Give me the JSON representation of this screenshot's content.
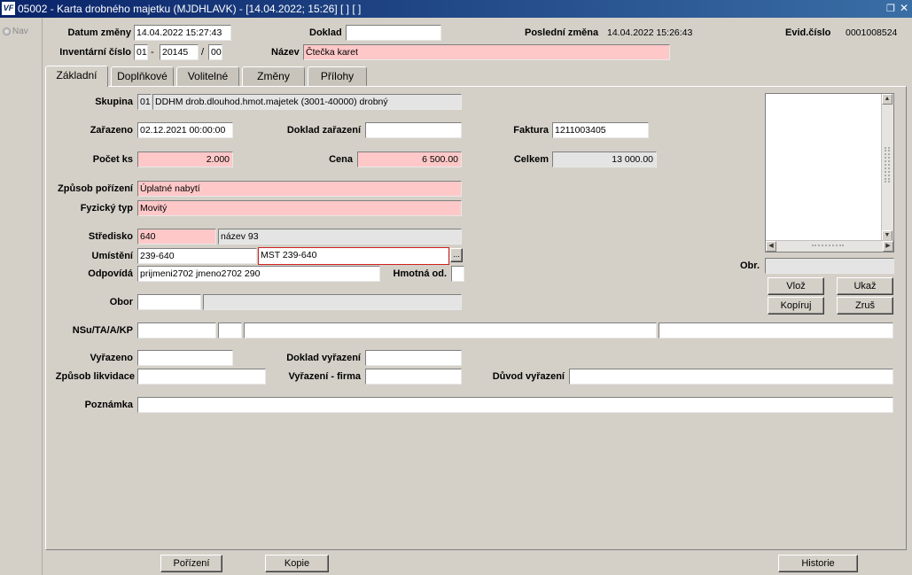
{
  "window": {
    "title": "05002 - Karta drobného majetku (MJDHLAVK) - [14.04.2022; 15:26]  [ ]  [ ]",
    "logo": "VF"
  },
  "nav": {
    "label": "Nav"
  },
  "header": {
    "datum_zmeny_label": "Datum změny",
    "datum_zmeny": "14.04.2022 15:27:43",
    "doklad_label": "Doklad",
    "doklad": "",
    "posledni_zmena_label": "Poslední změna",
    "posledni_zmena": "14.04.2022 15:26:43",
    "evid_cislo_label": "Evid.číslo",
    "evid_cislo": "0001008524",
    "inv_cislo_label": "Inventární číslo",
    "inv_1": "01",
    "inv_sep1": "-",
    "inv_2": "20145",
    "inv_sep2": "/",
    "inv_3": "00",
    "nazev_label": "Název",
    "nazev": "Čtečka karet"
  },
  "tabs": [
    "Základní",
    "Doplňkové",
    "Volitelné",
    "Změny",
    "Přílohy"
  ],
  "form": {
    "skupina_label": "Skupina",
    "skupina_kod": "01",
    "skupina_text": "DDHM drob.dlouhod.hmot.majetek (3001-40000) drobný",
    "zarazeno_label": "Zařazeno",
    "zarazeno": "02.12.2021 00:00:00",
    "doklad_zarazeni_label": "Doklad zařazení",
    "doklad_zarazeni": "",
    "faktura_label": "Faktura",
    "faktura": "1211003405",
    "pocet_label": "Počet ks",
    "pocet": "2.000",
    "cena_label": "Cena",
    "cena": "6 500.00",
    "celkem_label": "Celkem",
    "celkem": "13 000.00",
    "zpusob_label": "Způsob pořízení",
    "zpusob": "Úplatné nabytí",
    "fyzicky_label": "Fyzický typ",
    "fyzicky": "Movitý",
    "stredisko_label": "Středisko",
    "stredisko": "640",
    "stredisko_nazev": "název 93",
    "umisteni_label": "Umístění",
    "umisteni": "239-640",
    "umisteni_nazev": "MST 239-640",
    "lookup": "...",
    "odpovida_label": "Odpovídá",
    "odpovida": "prijmeni2702 jmeno2702 290",
    "hmotna_label": "Hmotná od.",
    "hmotna": "",
    "obor_label": "Obor",
    "obor": "",
    "obor_nazev": "",
    "nsu_label": "NSu/TA/A/KP",
    "nsu_1": "",
    "nsu_2": "",
    "nsu_3": "",
    "nsu_4": "",
    "vyrazeno_label": "Vyřazeno",
    "vyrazeno": "",
    "doklad_vyrazeni_label": "Doklad vyřazení",
    "doklad_vyrazeni": "",
    "zpusob_likv_label": "Způsob likvidace",
    "zpusob_likv": "",
    "vyrazeni_firma_label": "Vyřazení - firma",
    "vyrazeni_firma": "",
    "duvod_label": "Důvod vyřazení",
    "duvod": "",
    "poznamka_label": "Poznámka",
    "poznamka": ""
  },
  "image_panel": {
    "obr_label": "Obr.",
    "obr": "",
    "vloz": "Vlož",
    "ukaz": "Ukaž",
    "kopiruj": "Kopíruj",
    "zrus": "Zruš"
  },
  "bottom": {
    "porizeni": "Pořízení",
    "kopie": "Kopie",
    "historie": "Historie"
  }
}
